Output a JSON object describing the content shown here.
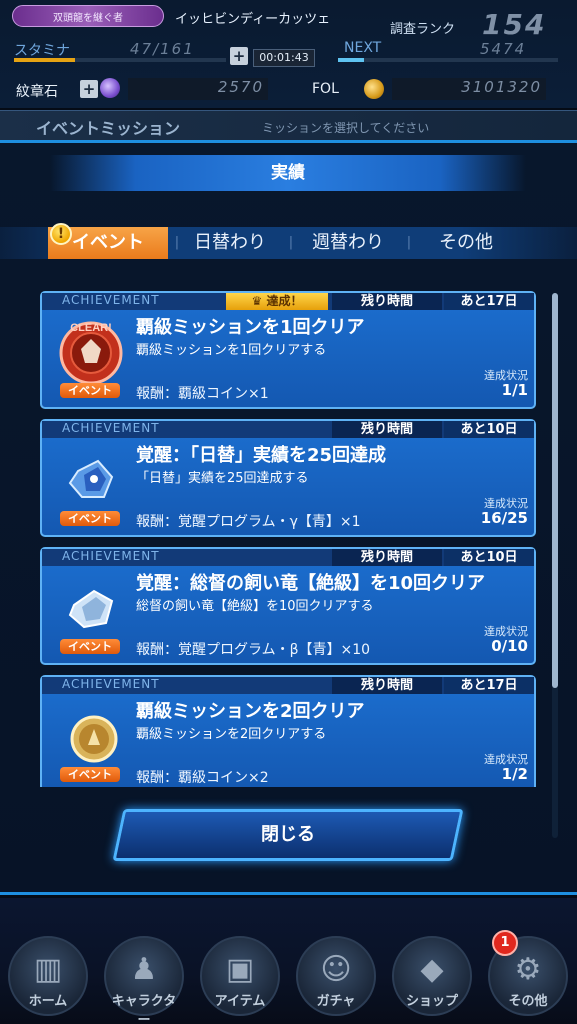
{
  "status": {
    "title": "双頭龍を継ぐ者",
    "player_name": "イッヒビンディーカッツェ",
    "rank_label": "調査ランク",
    "rank_value": "154",
    "stamina_label": "スタミナ",
    "stamina_value": "47/161",
    "stamina_fraction": 0.29,
    "plus": "+",
    "timer": "00:01:43",
    "next_label": "NEXT",
    "next_value": "5474",
    "next_fraction": 0.12,
    "crest_label": "紋章石",
    "crest_value": "2570",
    "fol_label": "FOL",
    "fol_value": "3101320"
  },
  "event_header": {
    "title": "イベントミッション",
    "hint": "ミッションを選択してください"
  },
  "modal": {
    "title": "実績",
    "tabs": [
      {
        "label": "イベント",
        "active": true
      },
      {
        "label": "日替わり",
        "active": false
      },
      {
        "label": "週替わり",
        "active": false
      },
      {
        "label": "その他",
        "active": false
      }
    ],
    "tab_separator": "|",
    "alert": "!",
    "close_label": "閉じる"
  },
  "missions": [
    {
      "ach_label": "ACHIEVEMENT",
      "achieved_badge": "達成！",
      "time_label": "残り時間",
      "time_value": "あと17日",
      "title": "覇級ミッションを1回クリア",
      "desc": "覇級ミッションを1回クリアする",
      "reward": "報酬：覇級コイン×1",
      "status_label": "達成状況",
      "status_value": "1/1",
      "tag": "イベント",
      "icon": "clear-medal-icon",
      "icon_stamp": "CLEAR!"
    },
    {
      "ach_label": "ACHIEVEMENT",
      "time_label": "残り時間",
      "time_value": "あと10日",
      "title": "覚醒：「日替」実績を25回達成",
      "desc": "「日替」実績を25回達成する",
      "reward": "報酬：覚醒プログラム・γ【青】×1",
      "status_label": "達成状況",
      "status_value": "16/25",
      "tag": "イベント",
      "icon": "blue-crystal-icon"
    },
    {
      "ach_label": "ACHIEVEMENT",
      "time_label": "残り時間",
      "time_value": "あと10日",
      "title": "覚醒：総督の飼い竜【絶級】を10回クリア",
      "desc": "総督の飼い竜【絶級】を10回クリアする",
      "reward": "報酬：覚醒プログラム・β【青】×10",
      "status_label": "達成状況",
      "status_value": "0/10",
      "tag": "イベント",
      "icon": "silver-crystal-icon"
    },
    {
      "ach_label": "ACHIEVEMENT",
      "time_label": "残り時間",
      "time_value": "あと17日",
      "title": "覇級ミッションを2回クリア",
      "desc": "覇級ミッションを2回クリアする",
      "reward": "報酬：覇級コイン×2",
      "status_label": "達成状況",
      "status_value": "1/2",
      "tag": "イベント",
      "icon": "gold-coin-icon"
    }
  ],
  "nav": [
    {
      "label": "ホーム",
      "icon": "home-icon",
      "glyph": "▥"
    },
    {
      "label": "キャラクター",
      "icon": "character-icon",
      "glyph": "♟"
    },
    {
      "label": "アイテム",
      "icon": "item-icon",
      "glyph": "▣"
    },
    {
      "label": "ガチャ",
      "icon": "gacha-icon",
      "glyph": "☺"
    },
    {
      "label": "ショップ",
      "icon": "shop-icon",
      "glyph": "◆"
    },
    {
      "label": "その他",
      "icon": "gear-icon",
      "glyph": "⚙"
    }
  ],
  "nav_badge": "1",
  "colors": {
    "accent_blue": "#1e8fe0",
    "tab_active": "#ea7b1c",
    "card_bg": "#1c6fd0",
    "achieved_gold": "#ffd54a"
  }
}
